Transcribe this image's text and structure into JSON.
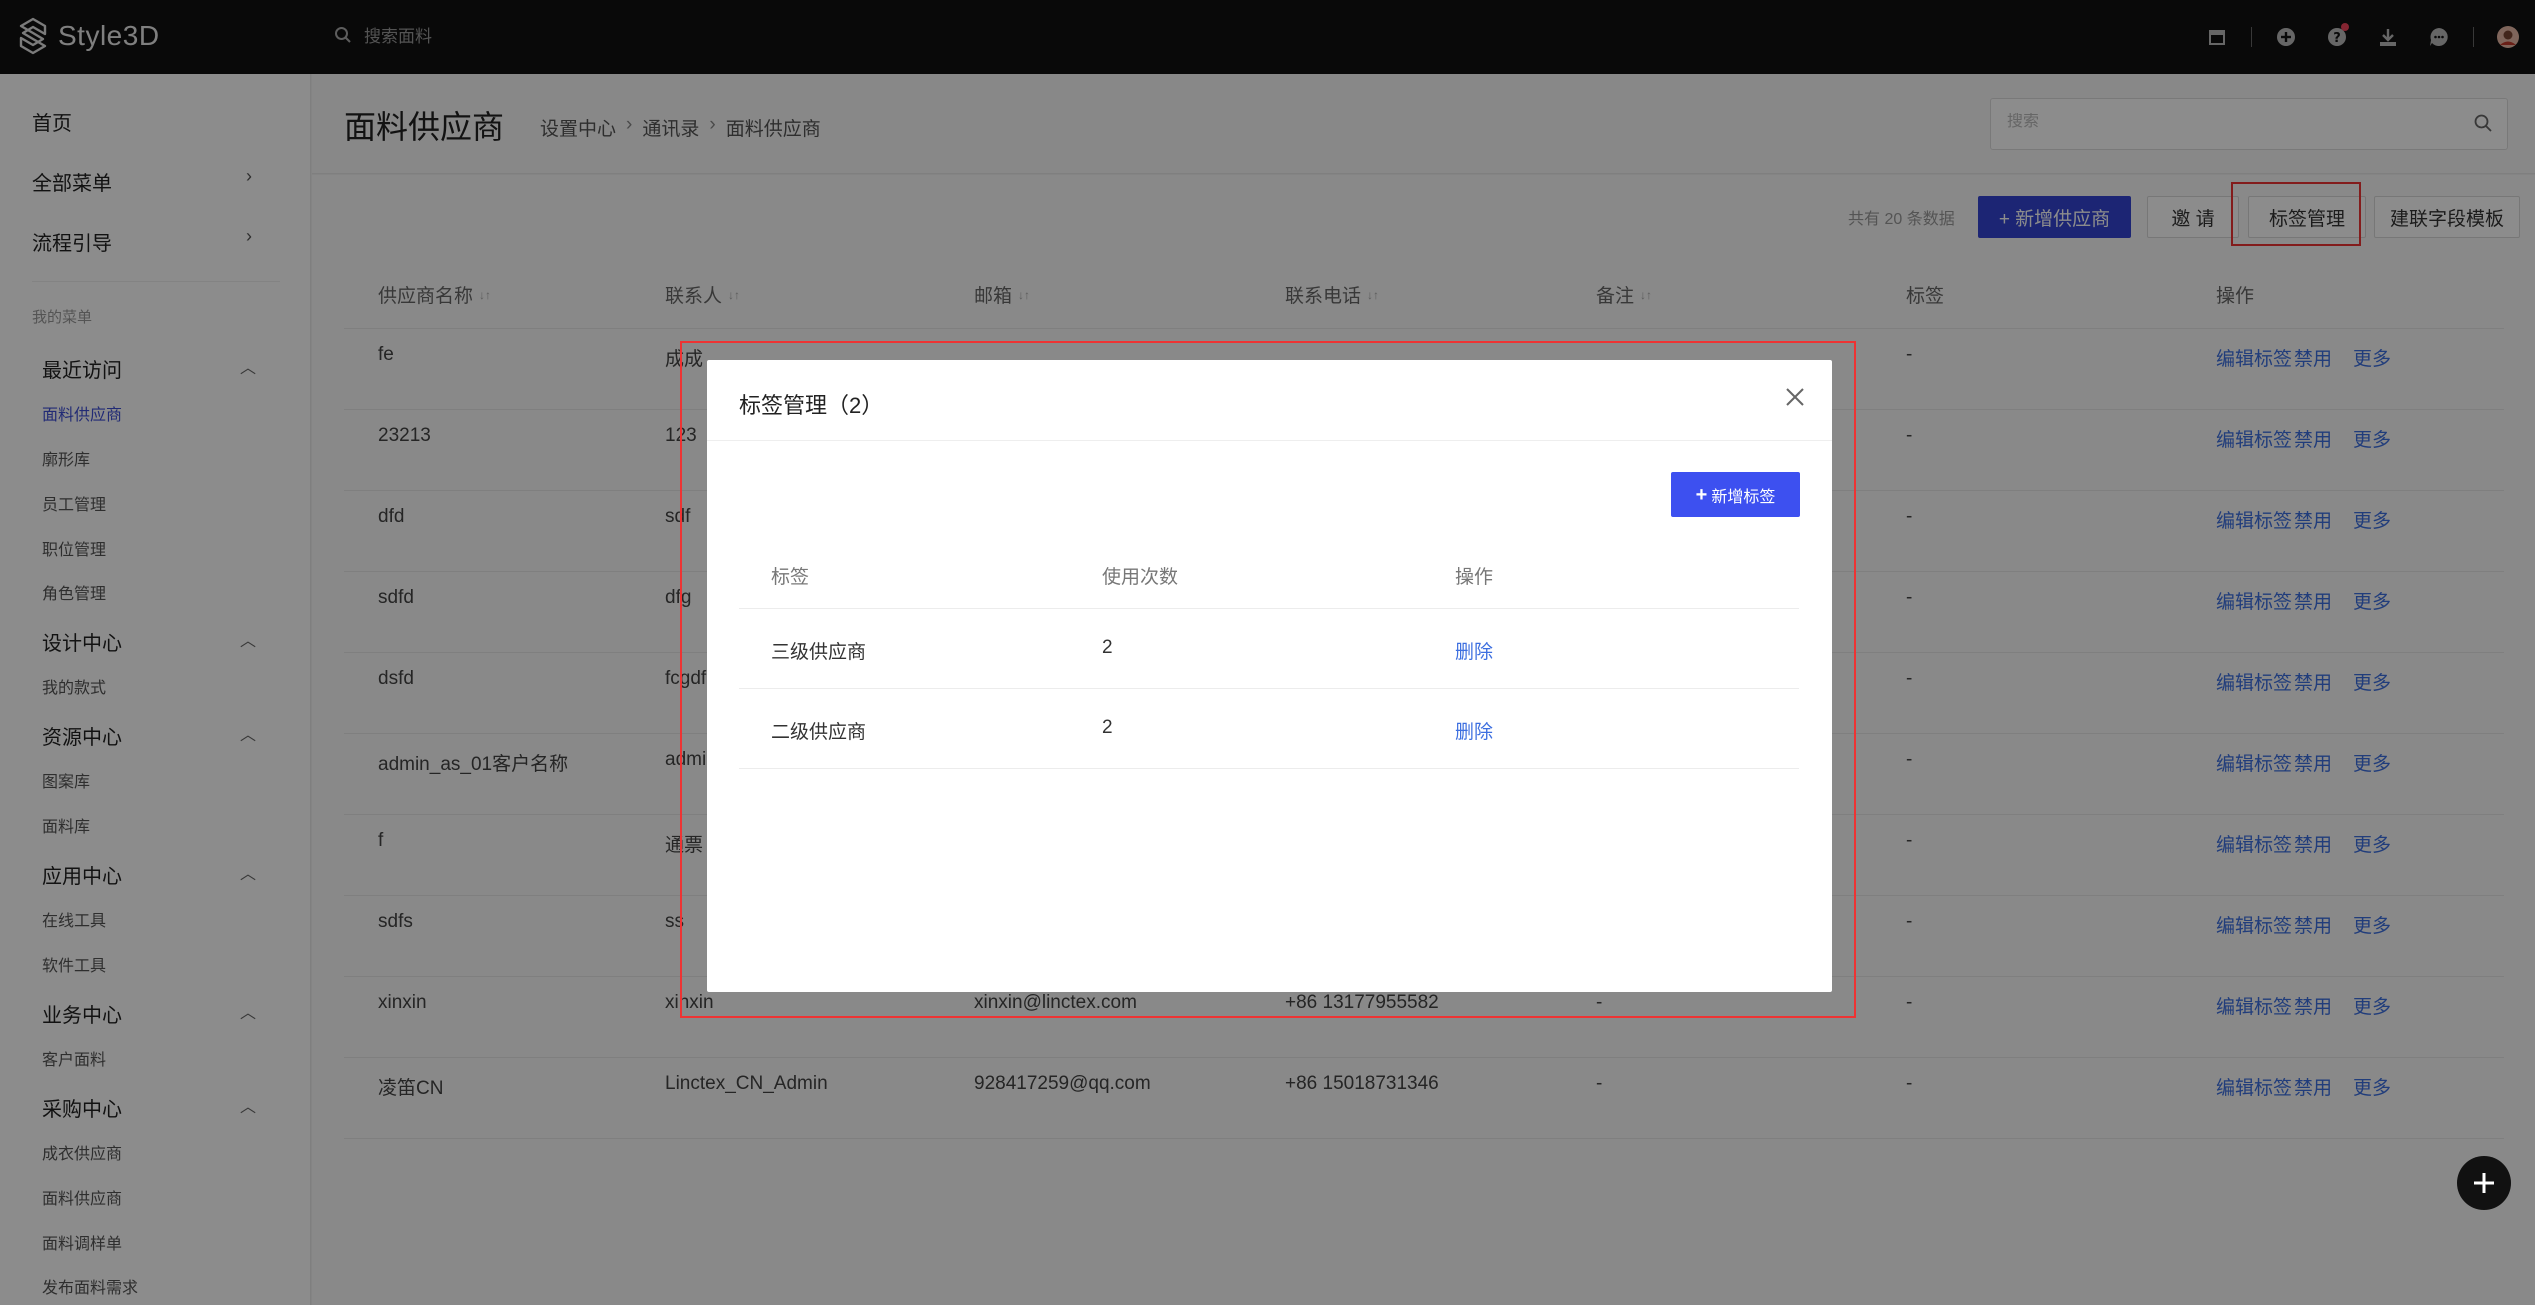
{
  "topbar": {
    "brand": "Style3D",
    "search_placeholder": "搜索面料"
  },
  "sidebar": {
    "top_items": [
      {
        "label": "首页"
      },
      {
        "label": "全部菜单"
      },
      {
        "label": "流程引导"
      }
    ],
    "caption": "我的菜单",
    "groups": [
      {
        "label": "最近访问",
        "items": [
          "面料供应商",
          "廓形库",
          "员工管理",
          "职位管理",
          "角色管理"
        ]
      },
      {
        "label": "设计中心",
        "items": [
          "我的款式"
        ]
      },
      {
        "label": "资源中心",
        "items": [
          "图案库",
          "面料库"
        ]
      },
      {
        "label": "应用中心",
        "items": [
          "在线工具",
          "软件工具"
        ]
      },
      {
        "label": "业务中心",
        "items": [
          "客户面料"
        ]
      },
      {
        "label": "采购中心",
        "items": [
          "成衣供应商",
          "面料供应商",
          "面料调样单",
          "发布面料需求"
        ]
      }
    ]
  },
  "header": {
    "title": "面料供应商",
    "breadcrumb": [
      "设置中心",
      "通讯录",
      "面料供应商"
    ],
    "search_placeholder": "搜索"
  },
  "toolbar": {
    "total": "共有 20 条数据",
    "add_supplier": "+ 新增供应商",
    "invite": "邀 请",
    "tag_manage": "标签管理",
    "field_template": "建联字段模板"
  },
  "table": {
    "headers": [
      "供应商名称",
      "联系人",
      "邮箱",
      "联系电话",
      "备注",
      "标签",
      "操作"
    ],
    "rows": [
      {
        "name": "fe",
        "contact": "成成",
        "email": "",
        "phone": "",
        "note": "",
        "tag": "-"
      },
      {
        "name": "23213",
        "contact": "123",
        "email": "",
        "phone": "",
        "note": "",
        "tag": "-"
      },
      {
        "name": "dfd",
        "contact": "sdf",
        "email": "",
        "phone": "",
        "note": "",
        "tag": "-"
      },
      {
        "name": "sdfd",
        "contact": "dfg",
        "email": "",
        "phone": "",
        "note": "",
        "tag": "-"
      },
      {
        "name": "dsfd",
        "contact": "fcgdf",
        "email": "",
        "phone": "",
        "note": "",
        "tag": "-"
      },
      {
        "name": "admin_as_01客户名称",
        "contact": "admin",
        "email": "",
        "phone": "",
        "note": "",
        "tag": "-"
      },
      {
        "name": "f",
        "contact": "通票",
        "email": "",
        "phone": "",
        "note": "",
        "tag": "-"
      },
      {
        "name": "sdfs",
        "contact": "ss",
        "email": "",
        "phone": "",
        "note": "",
        "tag": "-"
      },
      {
        "name": "xinxin",
        "contact": "xinxin",
        "email": "xinxin@linctex.com",
        "phone": "+86 13177955582",
        "note": "-",
        "tag": "-"
      },
      {
        "name": "凌笛CN",
        "contact": "Linctex_CN_Admin",
        "email": "928417259@qq.com",
        "phone": "+86 15018731346",
        "note": "-",
        "tag": "-"
      }
    ],
    "ops": [
      "编辑标签",
      "禁用",
      "更多"
    ]
  },
  "modal": {
    "title": "标签管理（2）",
    "add_label": "新增标签",
    "headers": [
      "标签",
      "使用次数",
      "操作"
    ],
    "rows": [
      {
        "tag": "三级供应商",
        "count": "2",
        "op": "删除"
      },
      {
        "tag": "二级供应商",
        "count": "2",
        "op": "删除"
      }
    ]
  },
  "colors": {
    "primary": "#3344d4",
    "link": "#3d6fe0",
    "highlight": "#ee3333"
  }
}
